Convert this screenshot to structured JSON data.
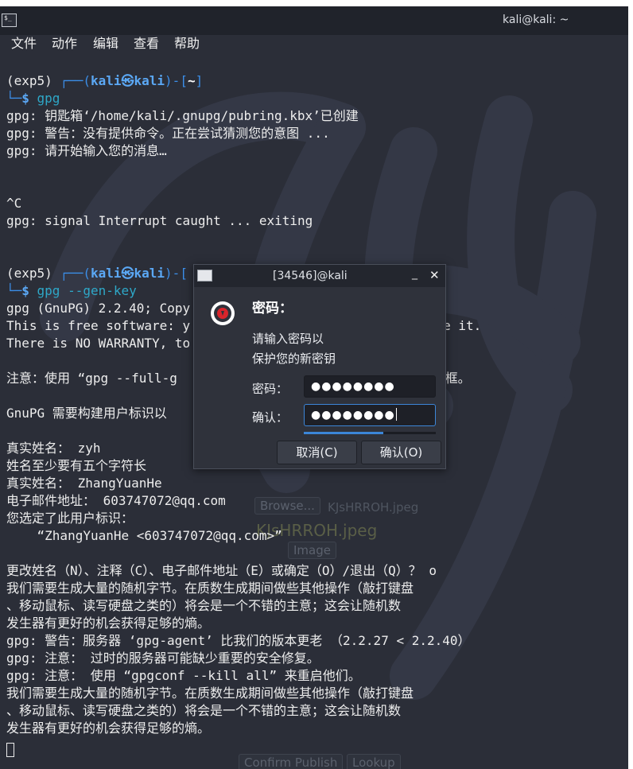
{
  "window": {
    "title": "kali@kali: ~",
    "icon": "terminal-icon"
  },
  "menu": [
    "文件",
    "动作",
    "编辑",
    "查看",
    "帮助"
  ],
  "terminal": {
    "lines": [
      {
        "segments": [
          {
            "t": "(exp5) ",
            "c": ""
          },
          {
            "t": "┌──(",
            "c": "p-blue"
          },
          {
            "t": "kali㉿kali",
            "c": "p-bold"
          },
          {
            "t": ")-[",
            "c": "p-blue"
          },
          {
            "t": "~",
            "c": "p-white"
          },
          {
            "t": "]",
            "c": "p-blue"
          }
        ]
      },
      {
        "segments": [
          {
            "t": "└─",
            "c": "p-blue"
          },
          {
            "t": "$ ",
            "c": "p-bold"
          },
          {
            "t": "gpg",
            "c": "p-cmd"
          }
        ]
      },
      {
        "segments": [
          {
            "t": "gpg: 钥匙箱‘/home/kali/.gnupg/pubring.kbx’已创建",
            "c": ""
          }
        ]
      },
      {
        "segments": [
          {
            "t": "gpg: 警告：没有提供命令。正在尝试猜测您的意图 ...",
            "c": ""
          }
        ]
      },
      {
        "segments": [
          {
            "t": "gpg: 请开始输入您的消息…",
            "c": ""
          }
        ]
      },
      {
        "segments": []
      },
      {
        "segments": []
      },
      {
        "segments": [
          {
            "t": "^C",
            "c": ""
          }
        ]
      },
      {
        "segments": [
          {
            "t": "gpg: signal Interrupt caught ... exiting",
            "c": ""
          }
        ]
      },
      {
        "segments": []
      },
      {
        "segments": []
      },
      {
        "segments": [
          {
            "t": "(exp5) ",
            "c": ""
          },
          {
            "t": "┌──(",
            "c": "p-blue"
          },
          {
            "t": "kali㉿kali",
            "c": "p-bold"
          },
          {
            "t": ")-[",
            "c": "p-blue"
          }
        ]
      },
      {
        "segments": [
          {
            "t": "└─",
            "c": "p-blue"
          },
          {
            "t": "$ ",
            "c": "p-bold"
          },
          {
            "t": "gpg --gen-key",
            "c": "p-cmd"
          }
        ]
      },
      {
        "segments": [
          {
            "t": "gpg (GnuPG) 2.2.40; Copy",
            "c": ""
          }
        ]
      },
      {
        "segments": [
          {
            "t": "This is free software: y                           tribute it.",
            "c": ""
          }
        ]
      },
      {
        "segments": [
          {
            "t": "There is NO WARRANTY, to",
            "c": ""
          }
        ]
      },
      {
        "segments": []
      },
      {
        "segments": [
          {
            "t": "注意：使用 “gpg --full-g                         密钥生成对话框。",
            "c": ""
          }
        ]
      },
      {
        "segments": []
      },
      {
        "segments": [
          {
            "t": "GnuPG 需要构建用户标识以",
            "c": ""
          }
        ]
      },
      {
        "segments": []
      },
      {
        "segments": [
          {
            "t": "真实姓名： zyh",
            "c": ""
          }
        ]
      },
      {
        "segments": [
          {
            "t": "姓名至少要有五个字符长",
            "c": ""
          }
        ]
      },
      {
        "segments": [
          {
            "t": "真实姓名： ZhangYuanHe",
            "c": ""
          }
        ]
      },
      {
        "segments": [
          {
            "t": "电子邮件地址： 603747072@qq.com",
            "c": ""
          }
        ]
      },
      {
        "segments": [
          {
            "t": "您选定了此用户标识：",
            "c": ""
          }
        ]
      },
      {
        "segments": [
          {
            "t": "    “ZhangYuanHe <603747072@qq.com>”",
            "c": ""
          }
        ]
      },
      {
        "segments": []
      },
      {
        "segments": [
          {
            "t": "更改姓名（N）、注释（C）、电子邮件地址（E）或确定（O）/退出（Q）？ o",
            "c": ""
          }
        ]
      },
      {
        "segments": [
          {
            "t": "我们需要生成大量的随机字节。在质数生成期间做些其他操作（敲打键盘",
            "c": ""
          }
        ]
      },
      {
        "segments": [
          {
            "t": "、移动鼠标、读写硬盘之类的）将会是一个不错的主意；这会让随机数",
            "c": ""
          }
        ]
      },
      {
        "segments": [
          {
            "t": "发生器有更好的机会获得足够的熵。",
            "c": ""
          }
        ]
      },
      {
        "segments": [
          {
            "t": "gpg: 警告：服务器 ‘gpg-agent’ 比我们的版本更老 （2.2.27 < 2.2.40）",
            "c": ""
          }
        ]
      },
      {
        "segments": [
          {
            "t": "gpg: 注意： 过时的服务器可能缺少重要的安全修复。",
            "c": ""
          }
        ]
      },
      {
        "segments": [
          {
            "t": "gpg: 注意： 使用 “gpgconf --kill all” 来重启他们。",
            "c": ""
          }
        ]
      },
      {
        "segments": [
          {
            "t": "我们需要生成大量的随机字节。在质数生成期间做些其他操作（敲打键盘",
            "c": ""
          }
        ]
      },
      {
        "segments": [
          {
            "t": "、移动鼠标、读写硬盘之类的）将会是一个不错的主意；这会让随机数",
            "c": ""
          }
        ]
      },
      {
        "segments": [
          {
            "t": "发生器有更好的机会获得足够的熵。",
            "c": ""
          }
        ]
      }
    ]
  },
  "background_gui": {
    "browse_button": "Browse...",
    "file_label": "KJsHRROH.jpeg",
    "file_large": "KJsHRROH.jpeg",
    "image_select": "Image",
    "confirm_button": "Confirm Publish",
    "lookup_button": "Lookup"
  },
  "dialog": {
    "title": "[34546]@kali",
    "minimize_glyph": "_",
    "close_glyph": "✕",
    "heading": "密码：",
    "description_line1": "请输入密码以",
    "description_line2": "保护您的新密钥",
    "password_label": "密码：",
    "password_value": "●●●●●●●●",
    "confirm_label": "确认：",
    "confirm_value": "●●●●●●●●",
    "quality_fraction": 0.6,
    "cancel_label": "取消(C)",
    "ok_label": "确认(O)",
    "lock_icon_color": "#d9252b"
  }
}
